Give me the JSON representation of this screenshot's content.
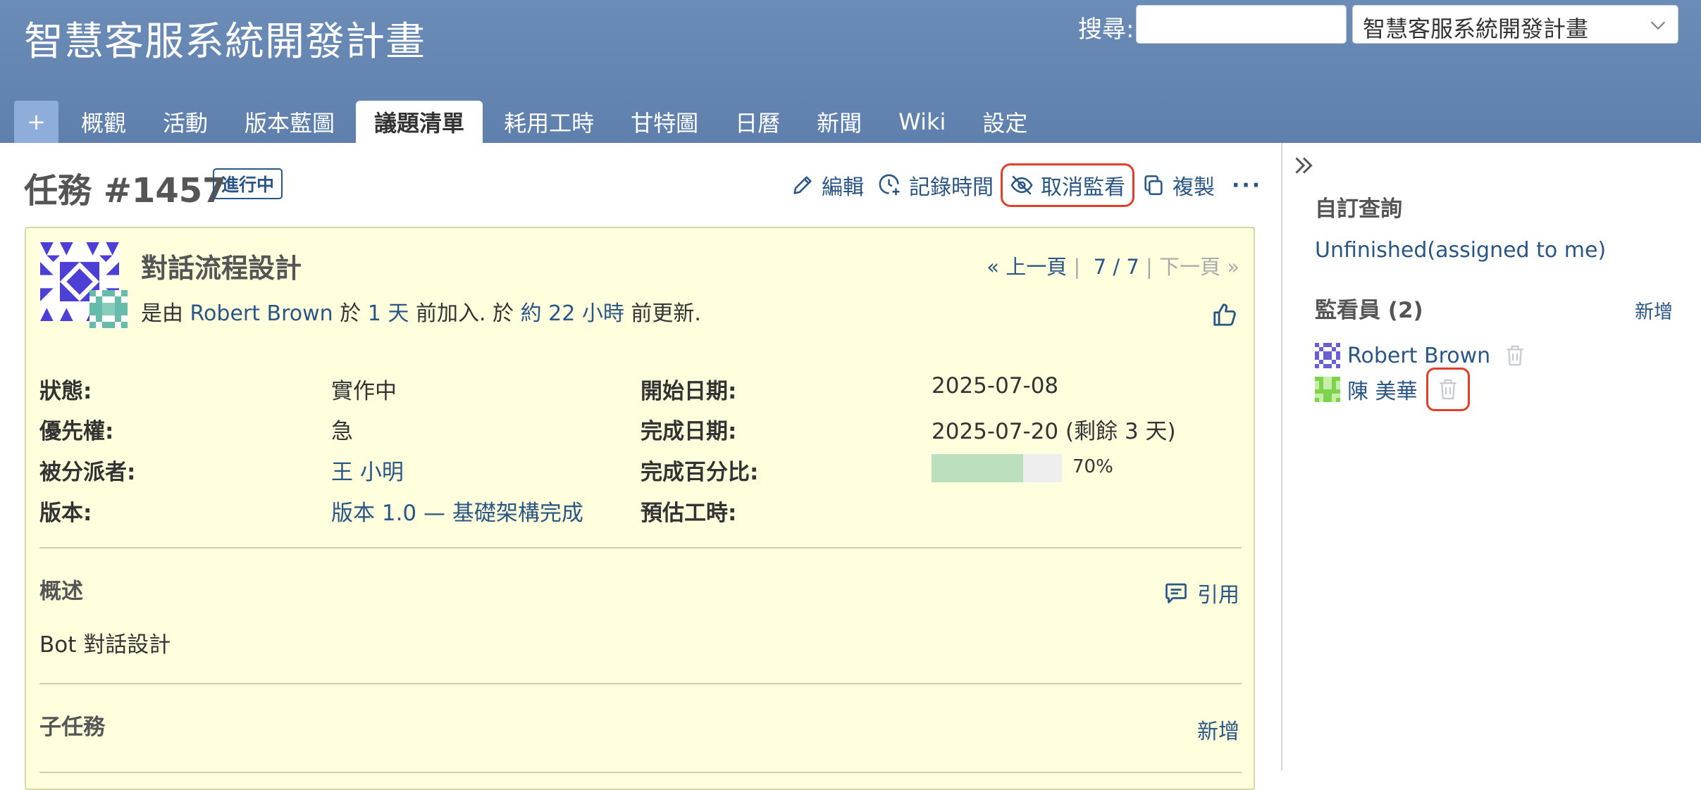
{
  "header": {
    "project_title": "智慧客服系統開發計畫",
    "search_label": "搜尋:",
    "search_value": "",
    "project_select": "智慧客服系統開發計畫"
  },
  "tabs": {
    "new_label": "+",
    "items": [
      "概觀",
      "活動",
      "版本藍圖",
      "議題清單",
      "耗用工時",
      "甘特圖",
      "日曆",
      "新聞",
      "Wiki",
      "設定"
    ],
    "selected": "議題清單"
  },
  "issue": {
    "heading": "任務 #1457",
    "status_badge": "進行中",
    "actions": {
      "edit": "編輯",
      "log_time": "記錄時間",
      "unwatch": "取消監看",
      "copy": "複製",
      "more": "···"
    },
    "subject": "對話流程設計",
    "author_prefix": "是由",
    "author": "Robert Brown",
    "author_mid1": "於",
    "created_ago": "1 天",
    "author_mid2": "前加入. 於",
    "updated_ago": "約 22 小時",
    "author_suffix": "前更新.",
    "pager": {
      "prev": "« 上一頁",
      "sep1": "|",
      "position": "7 / 7",
      "sep2": "|",
      "next": "下一頁 »"
    },
    "attributes": {
      "status_label": "狀態:",
      "status_value": "實作中",
      "priority_label": "優先權:",
      "priority_value": "急",
      "assignee_label": "被分派者:",
      "assignee_value": "王 小明",
      "version_label": "版本:",
      "version_value": "版本 1.0 — 基礎架構完成",
      "start_label": "開始日期:",
      "start_value": "2025-07-08",
      "due_label": "完成日期:",
      "due_value": "2025-07-20 (剩餘 3 天)",
      "done_label": "完成百分比:",
      "done_value": "70%",
      "done_ratio": 70,
      "estimate_label": "預估工時:",
      "estimate_value": ""
    },
    "description_title": "概述",
    "quote_label": "引用",
    "description_text": "Bot 對話設計",
    "subtasks_title": "子任務",
    "subtasks_add": "新增"
  },
  "sidebar": {
    "query_title": "自訂查詢",
    "query_link": "Unfinished(assigned to me)",
    "watchers_title": "監看員 (2)",
    "watchers_add": "新增",
    "watchers": [
      {
        "name": "Robert Brown"
      },
      {
        "name": "陳 美華"
      }
    ]
  },
  "colors": {
    "header_bg": "#6c8cb8",
    "link": "#2a5685",
    "issue_bg": "#ffffdd",
    "progress_fill": "#bce0be",
    "highlight": "#e0402a"
  }
}
